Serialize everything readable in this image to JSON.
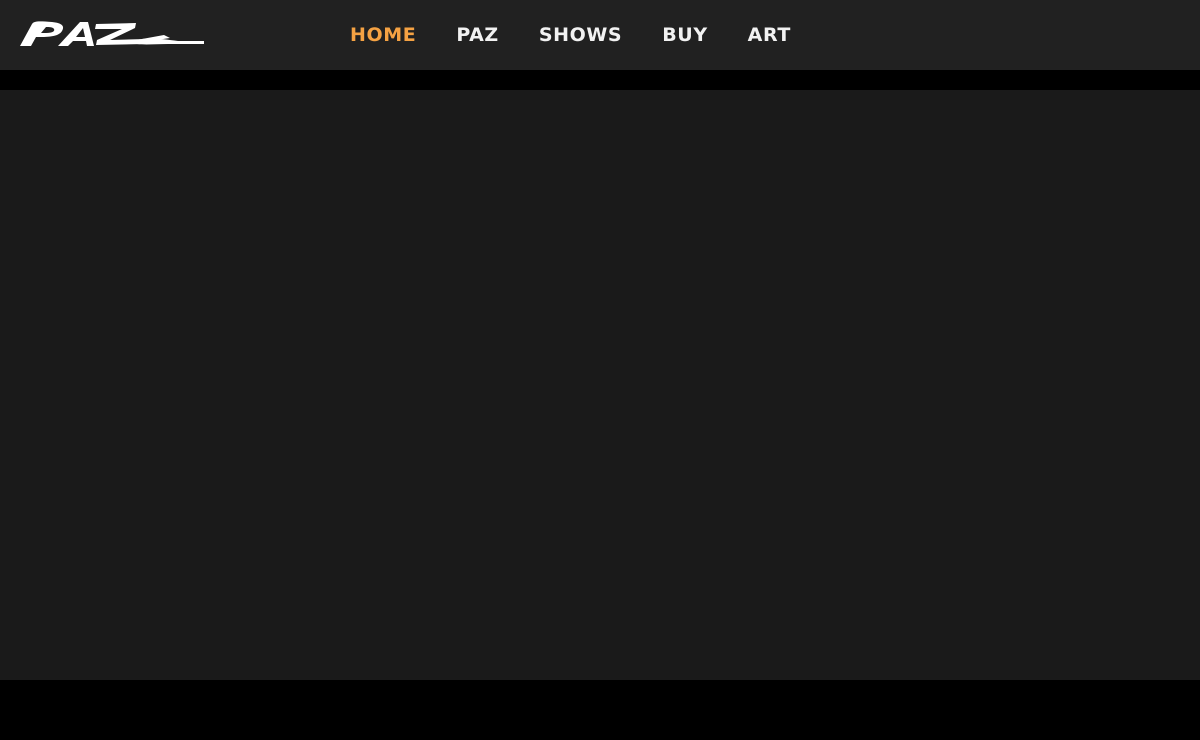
{
  "brand": {
    "logo_text": "PAZ",
    "logo_icon": "paz-brush-logo-icon"
  },
  "nav": {
    "items": [
      {
        "label": "HOME",
        "active": true
      },
      {
        "label": "PAZ",
        "active": false
      },
      {
        "label": "SHOWS",
        "active": false
      },
      {
        "label": "BUY",
        "active": false
      },
      {
        "label": "ART",
        "active": false
      }
    ]
  },
  "colors": {
    "header_bg": "#212121",
    "page_bg": "#000000",
    "hero_bg": "#1a1a1a",
    "nav_text": "#f2f2f2",
    "nav_active": "#f5a243"
  }
}
